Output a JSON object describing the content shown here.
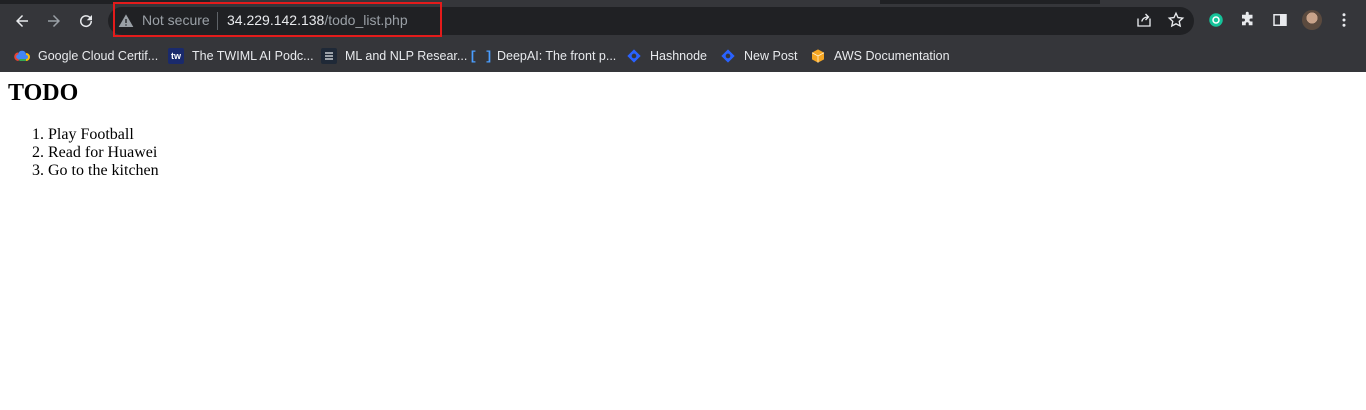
{
  "browser": {
    "security_label": "Not secure",
    "url_host": "34.229.142.138",
    "url_path": "/todo_list.php",
    "icons": {
      "back": "back-arrow-icon",
      "forward": "forward-arrow-icon",
      "reload": "reload-icon",
      "warning": "warning-icon",
      "share": "share-icon",
      "bookmark": "star-icon",
      "extension_green": "grammarly-icon",
      "extensions": "puzzle-icon",
      "side_panel": "side-panel-icon",
      "menu": "kebab-menu-icon"
    },
    "highlight_color": "#e31b1b"
  },
  "bookmarks": [
    {
      "label": "Google Cloud Certif...",
      "icon": "google-cloud-icon"
    },
    {
      "label": "The TWIML AI Podc...",
      "icon": "twiml-icon"
    },
    {
      "label": "ML and NLP Resear...",
      "icon": "ml-nlp-icon"
    },
    {
      "label": "DeepAI: The front p...",
      "icon": "deepai-icon"
    },
    {
      "label": "Hashnode",
      "icon": "hashnode-icon"
    },
    {
      "label": "New Post",
      "icon": "hashnode-icon"
    },
    {
      "label": "AWS Documentation",
      "icon": "aws-icon"
    }
  ],
  "page": {
    "title": "TODO",
    "items": [
      "Play Football",
      "Read for Huawei",
      "Go to the kitchen"
    ]
  }
}
